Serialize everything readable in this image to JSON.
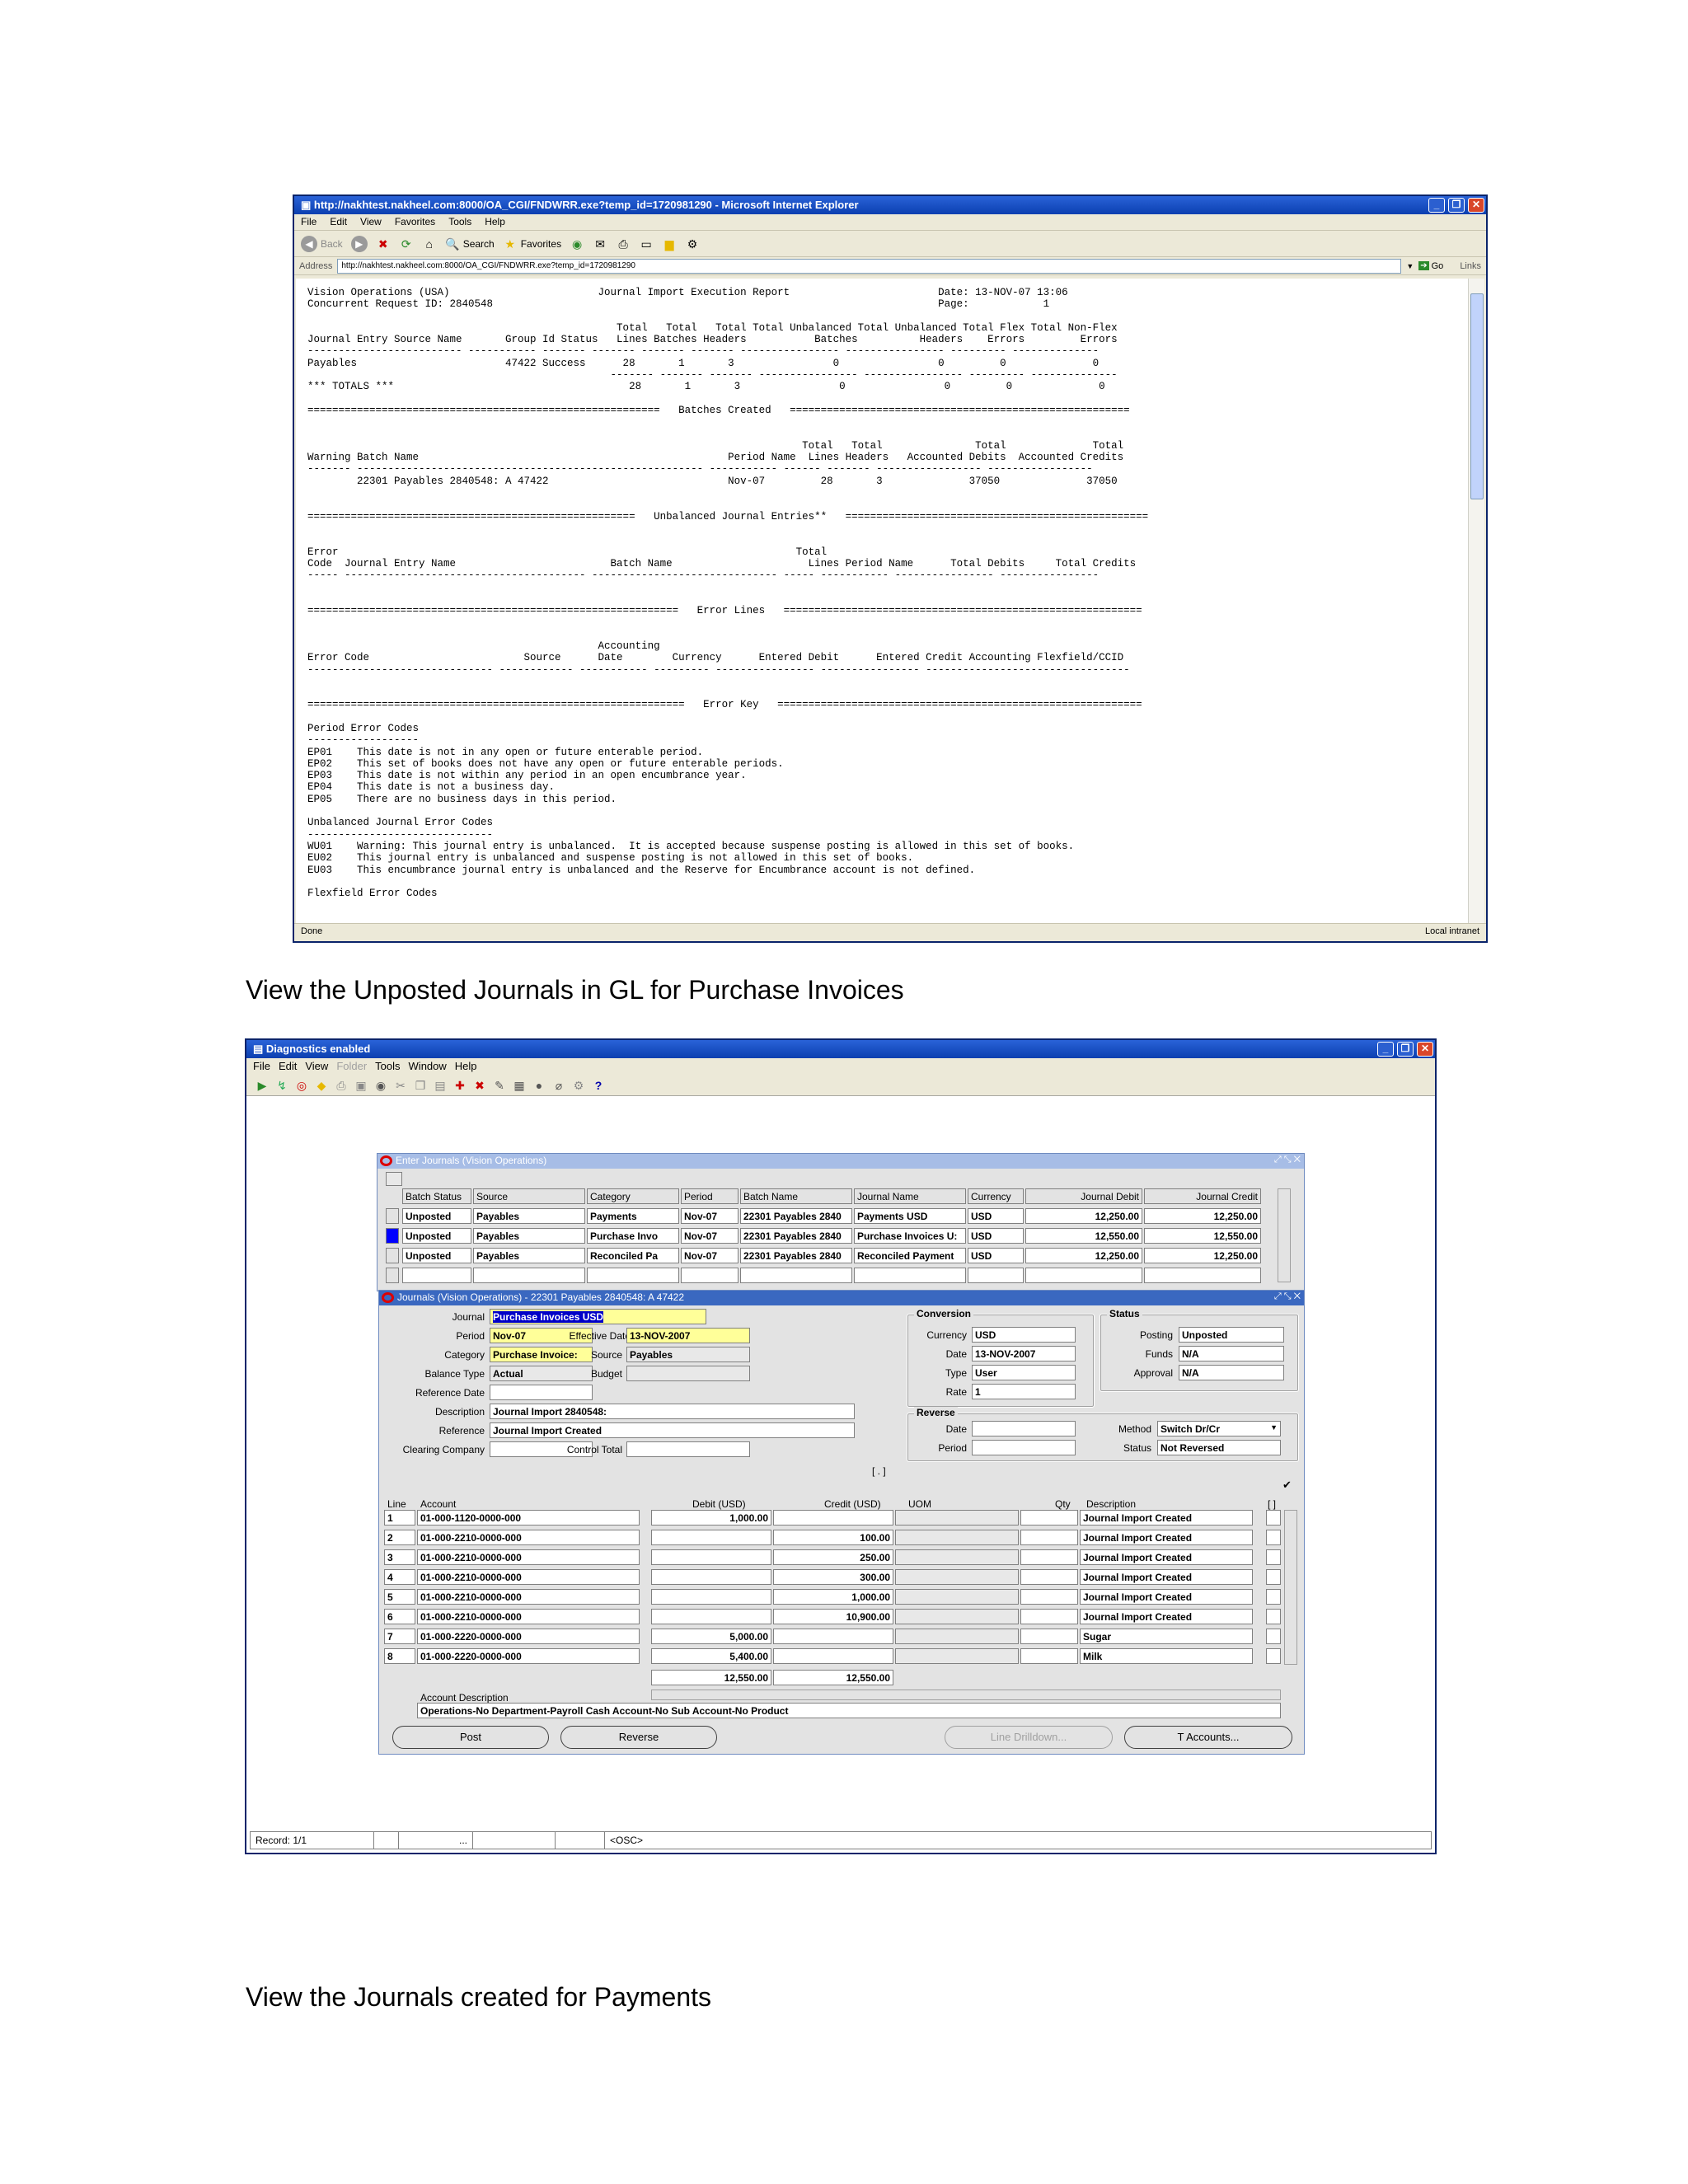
{
  "ie": {
    "title": "http://nakhtest.nakheel.com:8000/OA_CGI/FNDWRR.exe?temp_id=1720981290 - Microsoft Internet Explorer",
    "menu": [
      "File",
      "Edit",
      "View",
      "Favorites",
      "Tools",
      "Help"
    ],
    "toolbar": {
      "back": "Back",
      "search": "Search",
      "favorites": "Favorites"
    },
    "address_label": "Address",
    "address": "http://nakhtest.nakheel.com:8000/OA_CGI/FNDWRR.exe?temp_id=1720981290",
    "go": "Go",
    "links": "Links",
    "status_left": "Done",
    "status_right": "Local intranet",
    "report_lines": [
      "Vision Operations (USA)                        Journal Import Execution Report                        Date: 13-NOV-07 13:06",
      "Concurrent Request ID: 2840548                                                                        Page:            1",
      "",
      "                                                  Total   Total   Total Total Unbalanced Total Unbalanced Total Flex Total Non-Flex",
      "Journal Entry Source Name       Group Id Status   Lines Batches Headers           Batches          Headers    Errors         Errors",
      "------------------------- ----------- ------- ------- ------- ------- ---------------- ---------------- --------- --------------",
      "Payables                        47422 Success      28       1       3                0                0         0              0",
      "                                                 ------- ------- ------- ---------------- ---------------- --------- --------------",
      "*** TOTALS ***                                      28       1       3                0                0         0              0",
      "",
      "=========================================================   Batches Created   =======================================================",
      "",
      "",
      "                                                                                Total   Total               Total              Total",
      "Warning Batch Name                                                  Period Name  Lines Headers   Accounted Debits  Accounted Credits",
      "------- -------------------------------------------------------- ----------- ------ ------- ----------------- -----------------",
      "        22301 Payables 2840548: A 47422                             Nov-07         28       3              37050              37050",
      "",
      "",
      "=====================================================   Unbalanced Journal Entries**   =================================================",
      "",
      "",
      "Error                                                                          Total",
      "Code  Journal Entry Name                         Batch Name                      Lines Period Name      Total Debits     Total Credits",
      "----- --------------------------------------- ------------------------------ ----- ----------- ---------------- ----------------",
      "",
      "",
      "============================================================   Error Lines   ==========================================================",
      "",
      "",
      "                                               Accounting",
      "Error Code                         Source      Date        Currency      Entered Debit      Entered Credit Accounting Flexfield/CCID",
      "------------------------------ ------------ ----------- --------- ---------------- ---------------- ---------------------------------",
      "",
      "",
      "=============================================================   Error Key   ===========================================================",
      "",
      "Period Error Codes",
      "------------------",
      "EP01    This date is not in any open or future enterable period.",
      "EP02    This set of books does not have any open or future enterable periods.",
      "EP03    This date is not within any period in an open encumbrance year.",
      "EP04    This date is not a business day.",
      "EP05    There are no business days in this period.",
      "",
      "Unbalanced Journal Error Codes",
      "------------------------------",
      "WU01    Warning: This journal entry is unbalanced.  It is accepted because suspense posting is allowed in this set of books.",
      "EU02    This journal entry is unbalanced and suspense posting is not allowed in this set of books.",
      "EU03    This encumbrance journal entry is unbalanced and the Reserve for Encumbrance account is not defined.",
      "",
      "Flexfield Error Codes"
    ]
  },
  "captions": {
    "first": "View the Unposted Journals in GL for Purchase Invoices",
    "second": "View the Journals created for Payments"
  },
  "oracle": {
    "title": "Diagnostics enabled",
    "menu": [
      "File",
      "Edit",
      "View",
      "Folder",
      "Tools",
      "Window",
      "Help"
    ],
    "help_icon": "?",
    "status": {
      "record": "Record: 1/1",
      "dots": "...",
      "osc": "<OSC>"
    },
    "enter_journals": {
      "title": "Enter Journals (Vision Operations)",
      "headers": [
        "Batch Status",
        "Source",
        "Category",
        "Period",
        "Batch Name",
        "Journal Name",
        "Currency",
        "Journal Debit",
        "Journal Credit"
      ],
      "rows": [
        [
          "Unposted",
          "Payables",
          "Payments",
          "Nov-07",
          "22301 Payables 2840",
          "Payments USD",
          "USD",
          "12,250.00",
          "12,250.00"
        ],
        [
          "Unposted",
          "Payables",
          "Purchase Invo",
          "Nov-07",
          "22301 Payables 2840",
          "Purchase Invoices U:",
          "USD",
          "12,550.00",
          "12,550.00"
        ],
        [
          "Unposted",
          "Payables",
          "Reconciled Pa",
          "Nov-07",
          "22301 Payables 2840",
          "Reconciled Payment",
          "USD",
          "12,250.00",
          "12,250.00"
        ]
      ]
    },
    "journals": {
      "title": "Journals (Vision Operations) - 22301 Payables 2840548: A 47422",
      "labels": {
        "journal": "Journal",
        "period": "Period",
        "category": "Category",
        "balance_type": "Balance Type",
        "reference_date": "Reference Date",
        "description": "Description",
        "reference": "Reference",
        "clearing_company": "Clearing Company",
        "effective_date": "Effective Date",
        "source": "Source",
        "budget": "Budget",
        "control_total": "Control Total"
      },
      "values": {
        "journal": "Purchase Invoices USD",
        "period": "Nov-07",
        "category": "Purchase Invoice:",
        "balance_type": "Actual",
        "description": "Journal Import 2840548:",
        "reference": "Journal Import Created",
        "effective_date": "13-NOV-2007",
        "source": "Payables"
      },
      "conversion": {
        "title": "Conversion",
        "labels": {
          "currency": "Currency",
          "date": "Date",
          "type": "Type",
          "rate": "Rate"
        },
        "values": {
          "currency": "USD",
          "date": "13-NOV-2007",
          "type": "User",
          "rate": "1"
        }
      },
      "status": {
        "title": "Status",
        "labels": {
          "posting": "Posting",
          "funds": "Funds",
          "approval": "Approval"
        },
        "values": {
          "posting": "Unposted",
          "funds": "N/A",
          "approval": "N/A"
        }
      },
      "reverse": {
        "title": "Reverse",
        "labels": {
          "date": "Date",
          "period": "Period",
          "method": "Method",
          "status": "Status"
        },
        "values": {
          "method": "Switch Dr/Cr",
          "status": "Not Reversed"
        }
      },
      "bracket_field": "[ . ]",
      "check_glyph": "✔",
      "lines_headers": {
        "line": "Line",
        "account": "Account",
        "debit": "Debit (USD)",
        "credit": "Credit (USD)",
        "uom": "UOM",
        "qty": "Qty",
        "description": "Description",
        "flex": "[ ]"
      },
      "lines": [
        {
          "line": "1",
          "account": "01-000-1120-0000-000",
          "debit": "1,000.00",
          "credit": "",
          "desc": "Journal Import Created"
        },
        {
          "line": "2",
          "account": "01-000-2210-0000-000",
          "debit": "",
          "credit": "100.00",
          "desc": "Journal Import Created"
        },
        {
          "line": "3",
          "account": "01-000-2210-0000-000",
          "debit": "",
          "credit": "250.00",
          "desc": "Journal Import Created"
        },
        {
          "line": "4",
          "account": "01-000-2210-0000-000",
          "debit": "",
          "credit": "300.00",
          "desc": "Journal Import Created"
        },
        {
          "line": "5",
          "account": "01-000-2210-0000-000",
          "debit": "",
          "credit": "1,000.00",
          "desc": "Journal Import Created"
        },
        {
          "line": "6",
          "account": "01-000-2210-0000-000",
          "debit": "",
          "credit": "10,900.00",
          "desc": "Journal Import Created"
        },
        {
          "line": "7",
          "account": "01-000-2220-0000-000",
          "debit": "5,000.00",
          "credit": "",
          "desc": "Sugar"
        },
        {
          "line": "8",
          "account": "01-000-2220-0000-000",
          "debit": "5,400.00",
          "credit": "",
          "desc": "Milk"
        }
      ],
      "totals": {
        "debit": "12,550.00",
        "credit": "12,550.00"
      },
      "account_description_label": "Account Description",
      "account_description": "Operations-No Department-Payroll Cash Account-No Sub Account-No Product",
      "buttons": {
        "post": "Post",
        "reverse": "Reverse",
        "line_drilldown": "Line Drilldown...",
        "t_accounts": "T Accounts..."
      }
    }
  },
  "colors": {
    "titlebar": "#0b3fb0",
    "required_field": "#ffff99",
    "selected_row": "#0000ff"
  }
}
